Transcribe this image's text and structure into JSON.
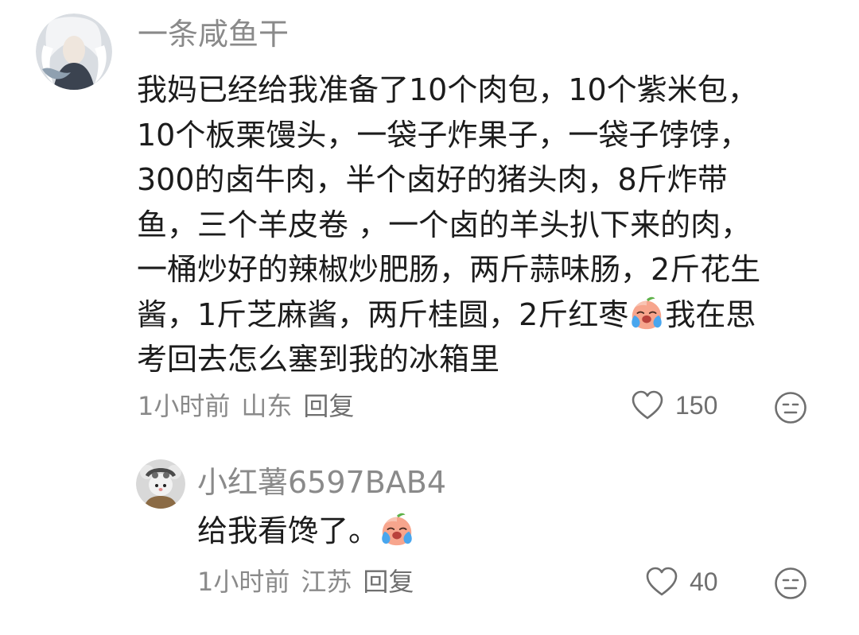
{
  "comments": [
    {
      "username": "一条咸鱼干",
      "text_lines": [
        "我妈已经给我准备了10个肉包，10个紫米包，",
        "10个板栗馒头，一袋子炸果子，一袋子饽饽，",
        "300的卤牛肉，半个卤好的猪头肉，8斤炸带",
        "鱼，三个羊皮卷 ，一个卤的羊头扒下来的肉，",
        "一桶炒好的辣椒炒肥肠，两斤蒜味肠，2斤花生",
        "酱，1斤芝麻酱，两斤桂圆，2斤红枣",
        "我在思",
        "考回去怎么塞到我的冰箱里"
      ],
      "time": "1小时前",
      "location": "山东",
      "reply_label": "回复",
      "likes": "150"
    },
    {
      "username": "小红薯6597BAB4",
      "text": "给我看馋了。",
      "time": "1小时前",
      "location": "江苏",
      "reply_label": "回复",
      "likes": "40"
    }
  ],
  "icons": {
    "like": "heart-outline-icon",
    "dislike": "unhappy-face-icon",
    "emoji": "crying-peach-emoji"
  },
  "colors": {
    "text": "#1c1c1c",
    "meta": "#8a8a8a",
    "icon": "#6f6f6f"
  }
}
